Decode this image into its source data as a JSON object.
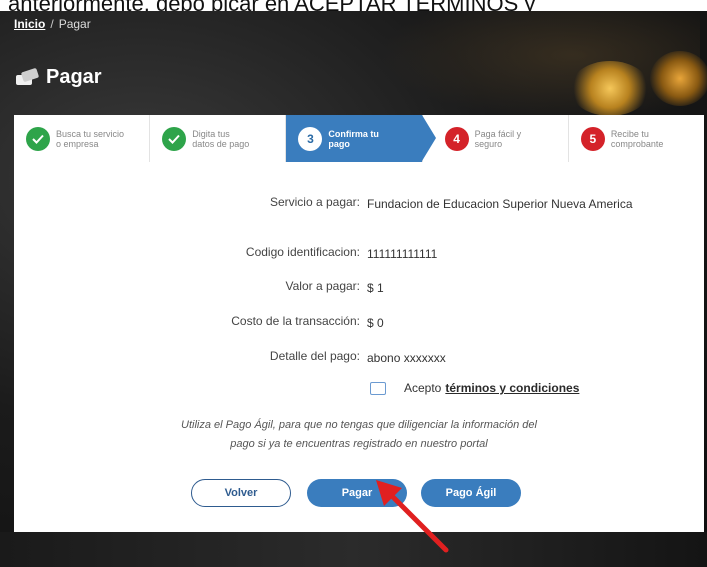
{
  "top_caption": "anteriormente, debo picar en ACEPTAR TÉRMINOS y",
  "breadcrumb": {
    "home": "Inicio",
    "separator": "/",
    "current": "Pagar"
  },
  "page_title": "Pagar",
  "steps": [
    {
      "number": "",
      "line1": "Busca tu servicio",
      "line2": "o empresa",
      "state": "done"
    },
    {
      "number": "",
      "line1": "Digita tus",
      "line2": "datos de pago",
      "state": "done"
    },
    {
      "number": "3",
      "line1": "Confirma tu",
      "line2": "pago",
      "state": "active"
    },
    {
      "number": "4",
      "line1": "Paga fácil y",
      "line2": "seguro",
      "state": "pending"
    },
    {
      "number": "5",
      "line1": "Recibe tu",
      "line2": "comprobante",
      "state": "pending"
    }
  ],
  "details": {
    "servicio_label": "Servicio a pagar:",
    "servicio_value": "Fundacion de Educacion Superior Nueva Americа",
    "codigo_label": "Codigo identificacion:",
    "codigo_value": "111111111111",
    "valor_label": "Valor a pagar:",
    "valor_value": "$ 1",
    "costo_label": "Costo de la transacción:",
    "costo_value": "$ 0",
    "detalle_label": "Detalle del pago:",
    "detalle_value": "abono xxxxxxx"
  },
  "terms": {
    "prefix": "Acepto",
    "link": "términos y condiciones"
  },
  "note_line1": "Utiliza el Pago Ágil, para que no tengas que diligenciar la información del",
  "note_line2": "pago si ya te encuentras registrado en nuestro portal",
  "buttons": {
    "back": "Volver",
    "pay": "Pagar",
    "agile": "Pago Ágil"
  },
  "colors": {
    "primary": "#3a7dbe",
    "done": "#2ea44a",
    "pending": "#d42229",
    "arrow": "#e02020"
  }
}
